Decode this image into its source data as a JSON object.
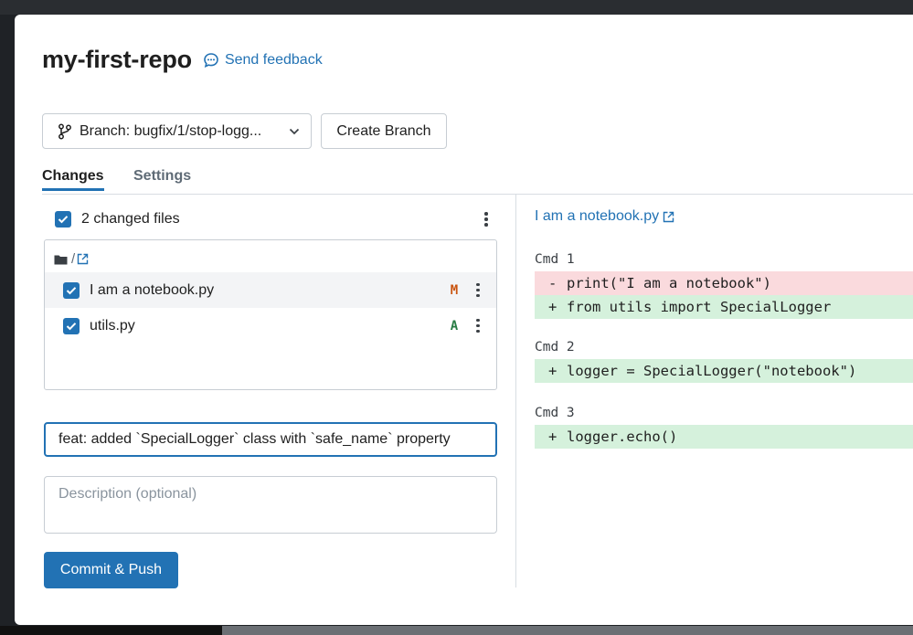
{
  "dialog": {
    "repo_name": "my-first-repo",
    "feedback_label": "Send feedback"
  },
  "branch": {
    "label": "Branch: bugfix/1/stop-logg...",
    "create_label": "Create Branch"
  },
  "tabs": [
    {
      "label": "Changes",
      "active": true
    },
    {
      "label": "Settings",
      "active": false
    }
  ],
  "changes": {
    "summary": "2 changed files",
    "folder": "/",
    "files": [
      {
        "name": "I am a notebook.py",
        "status": "M",
        "checked": true,
        "selected": true
      },
      {
        "name": "utils.py",
        "status": "A",
        "checked": true,
        "selected": false
      }
    ]
  },
  "commit": {
    "message_value": "feat: added `SpecialLogger` class with `safe_name` property",
    "description_placeholder": "Description (optional)",
    "button_label": "Commit & Push"
  },
  "diff": {
    "file_title": "I am a notebook.py",
    "cmds": [
      {
        "label": "Cmd 1",
        "lines": [
          {
            "type": "del",
            "sign": "-",
            "text": "print(\"I am a notebook\")"
          },
          {
            "type": "add",
            "sign": "+",
            "text": "from utils import SpecialLogger"
          }
        ]
      },
      {
        "label": "Cmd 2",
        "lines": [
          {
            "type": "add",
            "sign": "+",
            "text": "logger = SpecialLogger(\"notebook\")"
          }
        ]
      },
      {
        "label": "Cmd 3",
        "lines": [
          {
            "type": "add",
            "sign": "+",
            "text": "logger.echo()"
          }
        ]
      }
    ]
  },
  "colors": {
    "accent": "#2272b4",
    "modified": "#c9530e",
    "added": "#277c43",
    "diff_deleted_bg": "#fadadd",
    "diff_added_bg": "#d5f1dc"
  },
  "icons": {
    "feedback": "chat-bubble-icon",
    "branch": "git-branch-icon",
    "dropdown": "chevron-down-icon",
    "folder": "folder-icon",
    "external": "external-link-icon",
    "menu": "kebab-menu-icon",
    "checkbox": "checkmark-icon"
  }
}
